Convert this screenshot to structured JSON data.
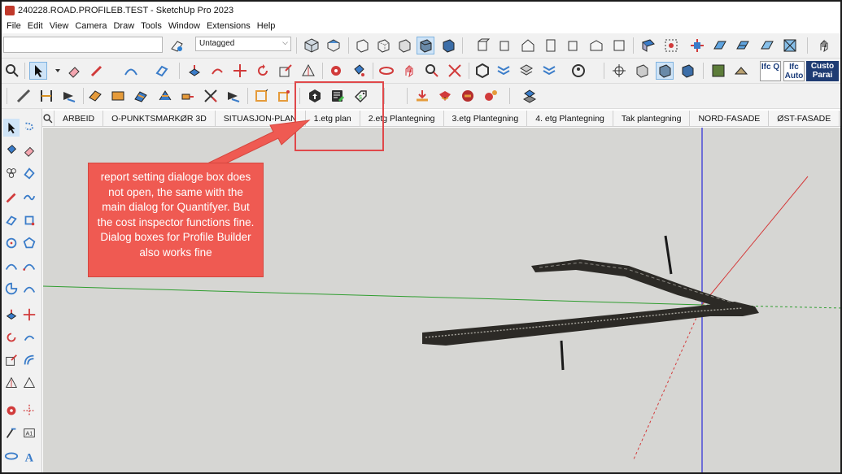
{
  "window": {
    "title": "240228.ROAD.PROFILEB.TEST - SketchUp Pro 2023"
  },
  "menu": {
    "items": [
      "File",
      "Edit",
      "View",
      "Camera",
      "Draw",
      "Tools",
      "Window",
      "Extensions",
      "Help"
    ]
  },
  "toolbar": {
    "tag_select_value": "Untagged",
    "ifc_q_label": "Ifc Q",
    "ifc_auto_label": "Ifc Auto",
    "custom_params_label": "Custo Parai"
  },
  "scenes": {
    "tabs": [
      "ARBEID",
      "O-PUNKTSMARKØR 3D",
      "SITUASJON-PLAN",
      "1.etg plan",
      "2.etg Plantegning",
      "3.etg Plantegning",
      "4. etg Plantegning",
      "Tak plantegning",
      "NORD-FASADE",
      "ØST-FASADE",
      "S"
    ]
  },
  "annotation": {
    "callout_text": "report setting dialoge box does not open, the same with the main dialog for Quantifyer. But the cost inspector functions fine. Dialog boxes for Profile Builder also works fine",
    "callout_color": "#ef5a52",
    "highlight_color": "#e0484a"
  },
  "colors": {
    "toolbar_bg": "#f1f1f1",
    "viewport_bg": "#d6d6d3",
    "axis_blue": "#2b2bd8",
    "axis_red": "#d43a3a",
    "axis_green": "#2f9d2f",
    "road_dark": "#2c2a26"
  },
  "icons": {
    "row1": [
      "view-iso-icon",
      "view-top-icon",
      "view-front-icon",
      "view-right-icon",
      "view-back-icon",
      "view-left-icon",
      "xray-icon",
      "back-edges-icon",
      "wireframe-icon",
      "hidden-line-icon",
      "shaded-icon",
      "shaded-textures-icon",
      "monochrome-icon",
      "house-icon",
      "building-icon",
      "walls-icon",
      "roof-icon",
      "section-icon",
      "component-icon",
      "solid-tools-icon",
      "sandbox-icon",
      "terrain-icon",
      "geo-icon"
    ],
    "row3_highlighted": [
      "quantifier-icon",
      "report-settings-icon",
      "cost-inspector-icon"
    ]
  }
}
